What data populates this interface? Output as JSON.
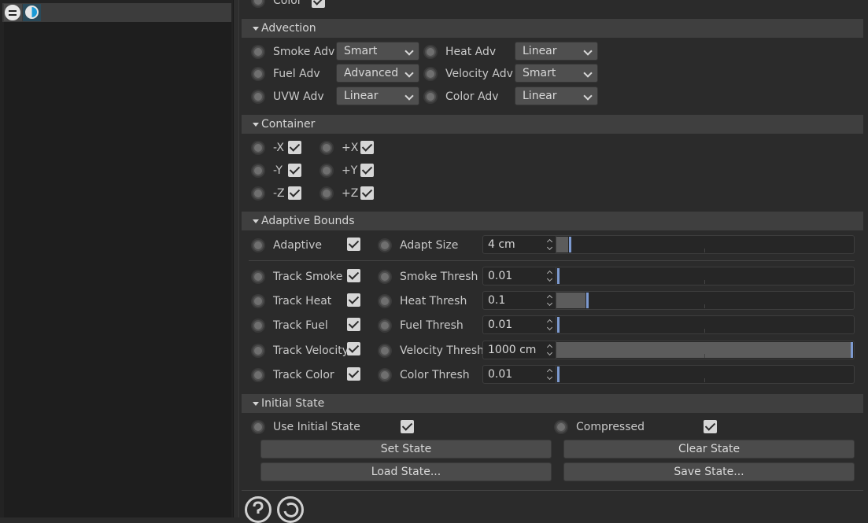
{
  "top_row": {
    "color_label": "Color"
  },
  "advection": {
    "title": "Advection",
    "rows": [
      {
        "left_label": "Smoke Adv",
        "left_value": "Smart",
        "right_label": "Heat Adv",
        "right_value": "Linear"
      },
      {
        "left_label": "Fuel Adv",
        "left_value": "Advanced",
        "right_label": "Velocity Adv",
        "right_value": "Smart"
      },
      {
        "left_label": "UVW Adv",
        "left_value": "Linear",
        "right_label": "Color Adv",
        "right_value": "Linear"
      }
    ]
  },
  "container": {
    "title": "Container",
    "items": [
      {
        "label": "-X",
        "checked": true
      },
      {
        "label": "+X",
        "checked": true
      },
      {
        "label": "-Y",
        "checked": true
      },
      {
        "label": "+Y",
        "checked": true
      },
      {
        "label": "-Z",
        "checked": true
      },
      {
        "label": "+Z",
        "checked": true
      }
    ]
  },
  "adaptive_bounds": {
    "title": "Adaptive Bounds",
    "adaptive": {
      "label": "Adaptive",
      "checked": true,
      "param_label": "Adapt Size",
      "value": "4 cm",
      "fraction": 0.04
    },
    "tracks": [
      {
        "label": "Track Smoke",
        "checked": true,
        "param_label": "Smoke Thresh",
        "value": "0.01",
        "fraction": 0.0
      },
      {
        "label": "Track Heat",
        "checked": true,
        "param_label": "Heat Thresh",
        "value": "0.1",
        "fraction": 0.1
      },
      {
        "label": "Track Fuel",
        "checked": true,
        "param_label": "Fuel Thresh",
        "value": "0.01",
        "fraction": 0.0
      },
      {
        "label": "Track Velocity",
        "checked": true,
        "param_label": "Velocity Thresh",
        "value": "1000 cm",
        "fraction": 1.0
      },
      {
        "label": "Track Color",
        "checked": true,
        "param_label": "Color Thresh",
        "value": "0.01",
        "fraction": 0.0
      }
    ]
  },
  "initial_state": {
    "title": "Initial State",
    "use_initial_state_label": "Use Initial State",
    "compressed_label": "Compressed",
    "buttons": {
      "set": "Set State",
      "clear": "Clear State",
      "load": "Load State...",
      "save": "Save State..."
    }
  },
  "icons": {
    "attribute_manager": "attribute-manager-icon",
    "layer": "layer-icon",
    "help": "help-icon",
    "reset": "reset-icon"
  },
  "colors": {
    "accent": "#7d9ad0",
    "layer_icon": "#1a9ad6"
  }
}
